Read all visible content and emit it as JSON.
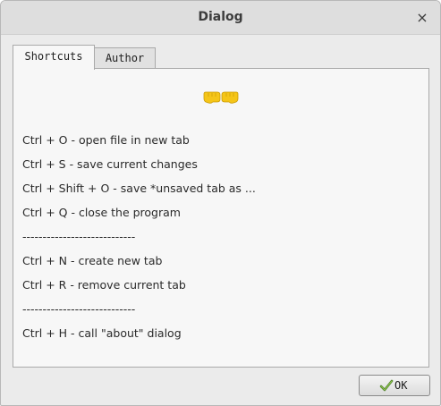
{
  "window": {
    "title": "Dialog",
    "close_icon": "×"
  },
  "tabs": [
    {
      "label": "Shortcuts",
      "active": true
    },
    {
      "label": "Author",
      "active": false
    }
  ],
  "shortcuts_pane": {
    "icon": "fist-bump-icon",
    "lines": [
      "Ctrl + O - open file in new tab",
      "Ctrl + S - save current changes",
      "Ctrl + Shift + O - save *unsaved tab as ...",
      "Ctrl + Q - close the program",
      "----------------------------",
      "Ctrl + N - create new tab",
      "Ctrl + R - remove current tab",
      "----------------------------",
      "Ctrl + H - call \"about\" dialog"
    ]
  },
  "footer": {
    "ok_label": "OK",
    "ok_icon": "checkmark-icon"
  },
  "colors": {
    "accent_icon": "#f5c518",
    "ok_icon": "#4a7a2a"
  }
}
